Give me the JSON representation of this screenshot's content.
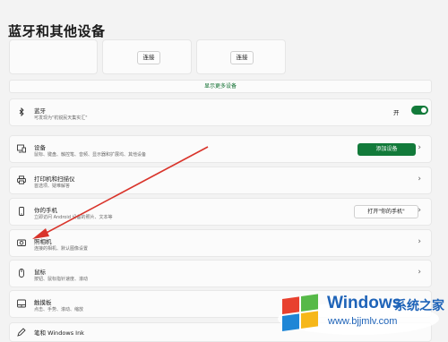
{
  "page": {
    "title": "蓝牙和其他设备"
  },
  "device_cards": {
    "connect_label_1": "连接",
    "connect_label_2": "连接"
  },
  "show_more_label": "显示更多设备",
  "rows": {
    "bluetooth": {
      "label": "蓝牙",
      "subtitle": "可发现为\"杭锐民天集实汇\"",
      "toggle_label": "开",
      "toggle_on": true
    },
    "devices": {
      "label": "设备",
      "subtitle": "鼠标、键盘、触控笔、音频、显示器和扩展坞、其他设备",
      "add_button": "添加设备"
    },
    "printers": {
      "label": "打印机和扫描仪",
      "subtitle": "首选项、疑难解答"
    },
    "phone": {
      "label": "你的手机",
      "subtitle": "立即访问 Android 设备的照片、文本等",
      "open_button": "打开\"你的手机\""
    },
    "camera": {
      "label": "照相机",
      "subtitle": "连接的相机、默认图像设置"
    },
    "mouse": {
      "label": "鼠标",
      "subtitle": "按钮、鼠标指针速度、滚动"
    },
    "touchpad": {
      "label": "触摸板",
      "subtitle": "点击、手势、滚动、缩放"
    },
    "pen": {
      "label": "笔和 Windows Ink"
    }
  },
  "watermark": {
    "brand": "Windows",
    "cn": "系统之家",
    "url": "www.bjjmlv.com"
  },
  "colors": {
    "accent": "#127a3a",
    "arrow": "#d9342b",
    "watermark": "#1e63b8"
  }
}
